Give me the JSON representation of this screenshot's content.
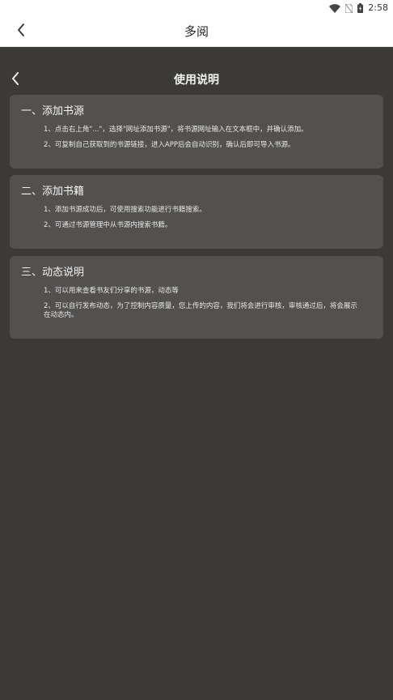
{
  "status_bar": {
    "time": "2:58",
    "icons": [
      "wifi-icon",
      "no-sim-icon",
      "battery-icon"
    ]
  },
  "app_bar": {
    "back_icon": "chevron-left-icon",
    "title": "多阅"
  },
  "page": {
    "back_icon": "chevron-left-icon",
    "title": "使用说明"
  },
  "sections": [
    {
      "title": "一、添加书源",
      "items": [
        "1、点击右上角\"...\"，选择\"网址添加书源\"，将书源网址输入在文本框中，并确认添加。",
        "2、可复制自己获取到的书源链接，进入APP后会自动识别，确认后即可导入书源。"
      ]
    },
    {
      "title": "二、添加书籍",
      "items": [
        "1、添加书源成功后，可使用搜索功能进行书籍搜索。",
        "2、可通过书源管理中从书源内搜索书籍。"
      ]
    },
    {
      "title": "三、动态说明",
      "items": [
        "1、可以用来查看书友们分享的书源，动态等",
        "2、可以自行发布动态，为了控制内容质量，您上传的内容，我们将会进行审核，审核通过后，将会展示在动态内。"
      ]
    }
  ],
  "colors": {
    "background": "#3b3a37",
    "card": "#53514f",
    "app_bar": "#ffffff"
  }
}
